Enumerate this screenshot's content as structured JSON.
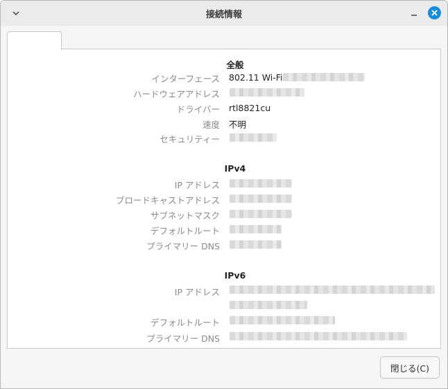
{
  "window": {
    "title": "接続情報",
    "icons": {
      "menu": "chevron-down-icon",
      "minimize": "minimize-icon",
      "close": "close-icon"
    },
    "accent": "#1a8cd8"
  },
  "general": {
    "heading": "全般",
    "interface_label": "インターフェース",
    "interface_value": "802.11 Wi-Fi",
    "hw_address_label": "ハードウェアアドレス",
    "driver_label": "ドライバー",
    "driver_value": "rtl8821cu",
    "speed_label": "速度",
    "speed_value": "不明",
    "security_label": "セキュリティー"
  },
  "ipv4": {
    "heading": "IPv4",
    "ip_label": "IP アドレス",
    "broadcast_label": "ブロードキャストアドレス",
    "subnet_label": "サブネットマスク",
    "gateway_label": "デフォルトルート",
    "dns_label": "プライマリー DNS"
  },
  "ipv6": {
    "heading": "IPv6",
    "ip_label": "IP アドレス",
    "gateway_label": "デフォルトルート",
    "dns_label": "プライマリー DNS"
  },
  "footer": {
    "close_label": "閉じる(C)"
  }
}
